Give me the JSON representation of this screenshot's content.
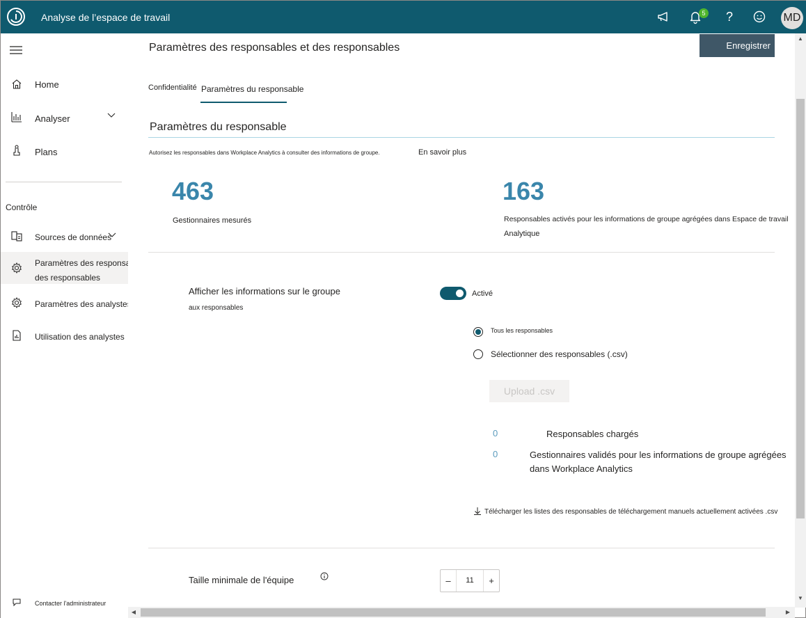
{
  "topbar": {
    "app_title": "Analyse de l’espace de travail",
    "notification_count": "5",
    "help_glyph": "?",
    "user_initials": "MD",
    "bg_color": "#0f5a6e",
    "icons": [
      "app-logo-icon",
      "megaphone-icon",
      "bell-icon",
      "help-icon",
      "smiley-icon"
    ]
  },
  "sidebar": {
    "items": [
      {
        "label": "Home",
        "icon": "home-icon"
      },
      {
        "label": "Analyser",
        "icon": "bar-chart-icon"
      },
      {
        "label": "Plans",
        "icon": "plans-icon"
      }
    ],
    "section_label": "Contrôle",
    "control_items": [
      {
        "label": "Sources de données",
        "icon": "data-sources-icon"
      },
      {
        "label": "Paramètres des responsables et",
        "label2": "des responsables",
        "icon": "gear-icon"
      },
      {
        "label": "Paramètres des analystes",
        "icon": "gear-icon"
      },
      {
        "label": "Utilisation des analystes",
        "icon": "report-icon"
      }
    ],
    "contact_admin": "Contacter l'administrateur"
  },
  "main": {
    "page_title": "Paramètres des responsables et des responsables",
    "save_label": "Enregistrer",
    "tabs": [
      {
        "label": "Confidentialité"
      },
      {
        "label": "Paramètres du responsable",
        "active": true
      }
    ],
    "section_title": "Paramètres du responsable",
    "description": "Autorisez les responsables dans Workplace Analytics à consulter des informations de groupe.",
    "learn_more": "En savoir plus",
    "stats": [
      {
        "value": "463",
        "label": "Gestionnaires mesurés"
      },
      {
        "value": "163",
        "label_line1": "Responsables activés pour les informations de groupe agrégées dans Espace de travail",
        "label_line2": "Analytique"
      }
    ],
    "group_setting": {
      "label": "Afficher les informations sur le groupe",
      "sublabel": "aux responsables",
      "toggle_state": "Activé",
      "toggle_on": true
    },
    "radio_options": [
      {
        "label": "Tous les responsables",
        "checked": true
      },
      {
        "label": "Sélectionner des responsables (.csv)",
        "checked": false
      }
    ],
    "upload_label": "Upload .csv",
    "upload_counts": [
      {
        "value": "0",
        "label": "Responsables chargés"
      },
      {
        "value": "0",
        "label_line1": "Gestionnaires validés pour les informations de groupe agrégées",
        "label_line2": "dans Workplace Analytics"
      }
    ],
    "download_link": "Télécharger les listes des responsables de téléchargement manuels actuellement activées .csv",
    "min_team": {
      "label": "Taille minimale de l'équipe",
      "decrement": "–",
      "value": "11",
      "increment": "+"
    }
  }
}
